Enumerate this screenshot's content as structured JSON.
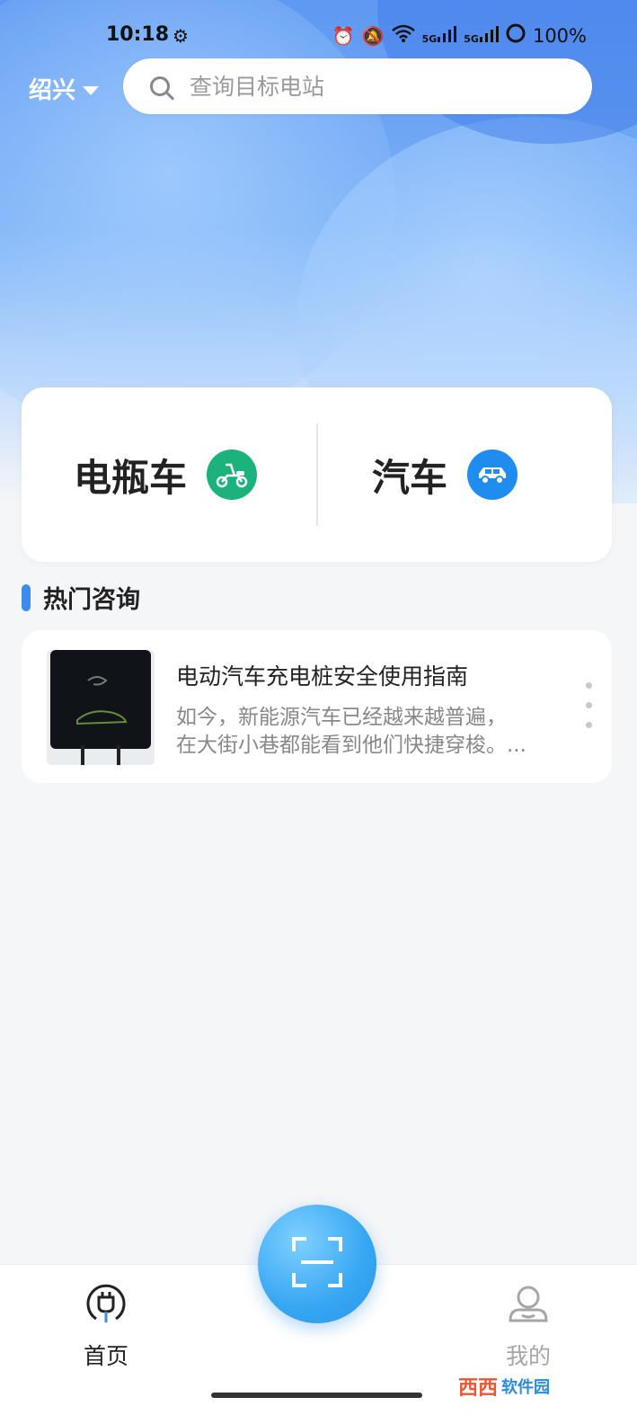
{
  "status_bar": {
    "time": "10:18",
    "signal1": "5G",
    "signal2": "5G",
    "battery": "100%"
  },
  "header": {
    "city": "绍兴",
    "search_placeholder": "查询目标电站"
  },
  "categories": [
    {
      "label": "电瓶车",
      "icon": "scooter-icon",
      "color": "#1bb27c"
    },
    {
      "label": "汽车",
      "icon": "car-icon",
      "color": "#1f8df0"
    }
  ],
  "section": {
    "title": "热门咨询"
  },
  "news": [
    {
      "title": "电动汽车充电桩安全使用指南",
      "line1": "如今，新能源汽车已经越来越普遍，",
      "line2": "在大街小巷都能看到他们快捷穿梭。..."
    }
  ],
  "tabbar": {
    "home_label": "首页",
    "mine_label": "我的",
    "active_color": "#222222",
    "inactive_color": "#a6a6a6"
  },
  "watermark": {
    "brand": "西西",
    "site": "软件园"
  }
}
